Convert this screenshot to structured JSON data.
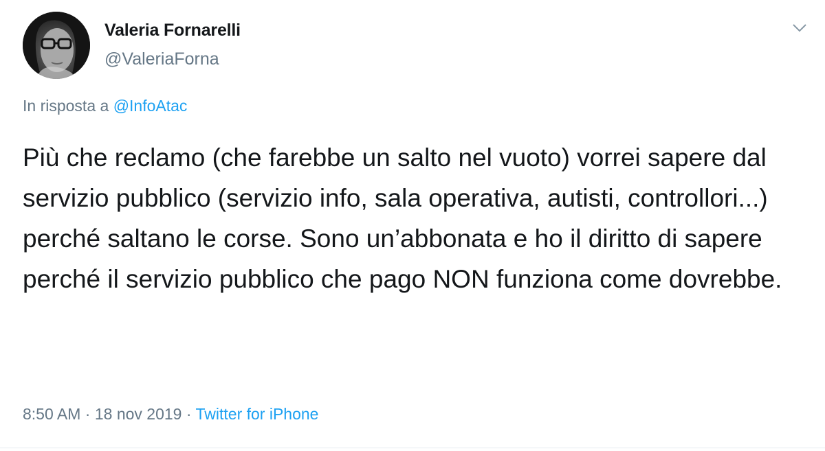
{
  "tweet": {
    "author": {
      "name": "Valeria Fornarelli",
      "handle": "@ValeriaForna"
    },
    "reply": {
      "prefix": "In risposta a ",
      "mention": "@InfoAtac"
    },
    "text": "Più che reclamo (che farebbe un salto nel vuoto) vorrei sapere dal servizio pubblico (servizio info, sala operativa, autisti, controllori...) perché saltano le corse. Sono un’abbonata e ho il diritto di sapere perché il servizio pubblico che pago NON funziona come dovrebbe.",
    "meta": {
      "time": "8:50 AM",
      "separator1": " · ",
      "date": "18 nov 2019",
      "separator2": " · ",
      "source": "Twitter for iPhone"
    },
    "icons": {
      "menu": "chevron-down-icon",
      "avatar": "avatar"
    },
    "colors": {
      "text": "#14171a",
      "secondary": "#657786",
      "link": "#1da1f2",
      "divider": "#e6ecf0"
    }
  }
}
